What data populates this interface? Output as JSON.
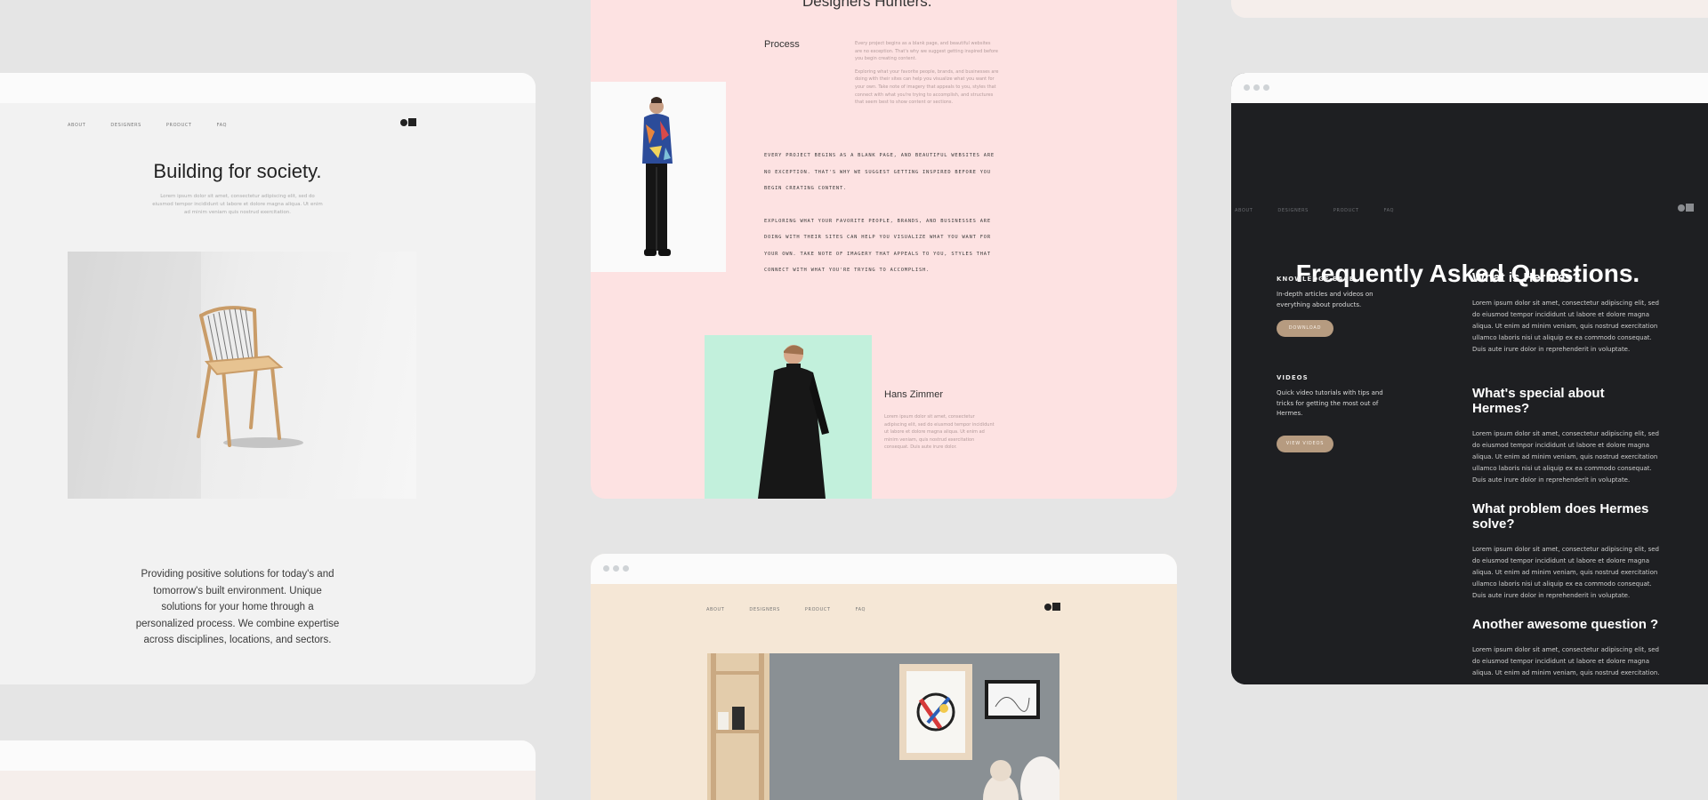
{
  "nav": [
    "About",
    "Designers",
    "Product",
    "FAQ"
  ],
  "building": {
    "title": "Building for society.",
    "subtitle": "Lorem ipsum dolor sit amet, consectetur adipiscing elit, sed do eiusmod tempor incididunt ut labore et dolore magna aliqua. Ut enim ad minim veniam quis nostrud exercitation.",
    "body": "Providing positive solutions for today's and tomorrow's built environment. Unique solutions for your home through a personalized process. We combine expertise across disciplines, locations, and sectors."
  },
  "pink": {
    "top_title": "Designers Hunters.",
    "process_title": "Process",
    "process_text": [
      "Every project begins as a blank page, and beautiful websites are no exception. That's why we suggest getting inspired before you begin creating content.",
      "Exploring what your favorite people, brands, and businesses are doing with their sites can help you visualize what you want for your own. Take note of imagery that appeals to you, styles that connect with what you're trying to accomplish, and structures that seem best to show content or sections."
    ],
    "mono_text": [
      "Every project begins as a blank page, and beautiful websites are no exception. That's why we suggest getting inspired before you begin creating content.",
      "Exploring what your favorite people, brands, and businesses are doing with their sites can help you visualize what you want for your own. Take note of imagery that appeals to you, styles that connect with what you're trying to accomplish."
    ],
    "person_name": "Hans Zimmer",
    "person_text": "Lorem ipsum dolor sit amet, consectetur adipiscing elit, sed do eiusmod tempor incididunt ut labore et dolore magna aliqua. Ut enim ad minim veniam, quis nostrud exercitation consequat. Duis aute irure dolor."
  },
  "faq": {
    "title": "Frequently Asked Questions.",
    "kb_title": "KNOWLEDGE BASE",
    "kb_text": "In-depth articles and videos on everything about products.",
    "kb_button": "Download",
    "videos_title": "VIDEOS",
    "videos_text": "Quick video tutorials with tips and tricks for getting the most out of Hermes.",
    "videos_button": "View videos",
    "questions": [
      {
        "q": "What is Hermes?",
        "a": "Lorem ipsum dolor sit amet, consectetur adipiscing elit, sed do eiusmod tempor incididunt ut labore et dolore magna aliqua. Ut enim ad minim veniam, quis nostrud exercitation ullamco laboris nisi ut aliquip ex ea commodo consequat. Duis aute irure dolor in reprehenderit in voluptate."
      },
      {
        "q": "What's special about Hermes?",
        "a": "Lorem ipsum dolor sit amet, consectetur adipiscing elit, sed do eiusmod tempor incididunt ut labore et dolore magna aliqua. Ut enim ad minim veniam, quis nostrud exercitation ullamco laboris nisi ut aliquip ex ea commodo consequat. Duis aute irure dolor in reprehenderit in voluptate."
      },
      {
        "q": "What problem does Hermes solve?",
        "a": "Lorem ipsum dolor sit amet, consectetur adipiscing elit, sed do eiusmod tempor incididunt ut labore et dolore magna aliqua. Ut enim ad minim veniam, quis nostrud exercitation ullamco laboris nisi ut aliquip ex ea commodo consequat. Duis aute irure dolor in reprehenderit in voluptate."
      },
      {
        "q": "Another awesome question ?",
        "a": "Lorem ipsum dolor sit amet, consectetur adipiscing elit, sed do eiusmod tempor incididunt ut labore et dolore magna aliqua. Ut enim ad minim veniam, quis nostrud exercitation."
      }
    ]
  },
  "colors": {
    "background": "#e5e5e5",
    "pink": "#fde2e2",
    "dark": "#1e1f22",
    "beige": "#f5e7d6",
    "pill": "#b69b80",
    "mint": "#c2f0dc"
  }
}
